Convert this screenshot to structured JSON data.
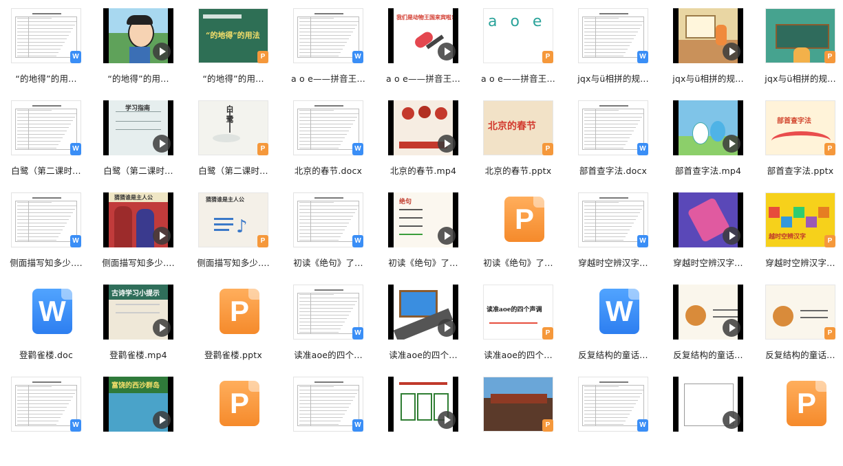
{
  "files": [
    {
      "label": "“的地得”的用...",
      "kind": "doc"
    },
    {
      "label": "“的地得”的用...",
      "kind": "video",
      "bg": "#5fa25a",
      "art": "cartoon"
    },
    {
      "label": "“的地得”的用...",
      "kind": "ppt",
      "bg": "#2e6f55",
      "art": "green"
    },
    {
      "label": "a o e——拼音王...",
      "kind": "doc"
    },
    {
      "label": "a o e——拼音王...",
      "kind": "video",
      "bg": "#ffffff",
      "art": "mic"
    },
    {
      "label": "a o e——拼音王...",
      "kind": "ppt",
      "bg": "#ffffff",
      "art": "aoe"
    },
    {
      "label": "jqx与ü相拼的规...",
      "kind": "doc"
    },
    {
      "label": "jqx与ü相拼的规...",
      "kind": "video",
      "bg": "#e9d6a3",
      "art": "classroom"
    },
    {
      "label": "jqx与ü相拼的规...",
      "kind": "ppt",
      "bg": "#46a38f",
      "art": "chalk"
    },
    {
      "label": "白鹭（第二课时...",
      "kind": "doc"
    },
    {
      "label": "白鹭（第二课时...",
      "kind": "video",
      "bg": "#e6eeee",
      "art": "scroll"
    },
    {
      "label": "白鹭（第二课时...",
      "kind": "ppt",
      "bg": "#f3f3ee",
      "art": "egret"
    },
    {
      "label": "北京的春节.docx",
      "kind": "doc"
    },
    {
      "label": "北京的春节.mp4",
      "kind": "video",
      "bg": "#f6ede2",
      "art": "food"
    },
    {
      "label": "北京的春节.pptx",
      "kind": "ppt",
      "bg": "#f2e2c7",
      "art": "spring"
    },
    {
      "label": "部首查字法.docx",
      "kind": "doc"
    },
    {
      "label": "部首查字法.mp4",
      "kind": "video",
      "bg": "#7fc4e8",
      "art": "rabbit"
    },
    {
      "label": "部首查字法.pptx",
      "kind": "ppt",
      "bg": "#fff3d9",
      "art": "rainbow"
    },
    {
      "label": "侧面描写知多少....",
      "kind": "doc"
    },
    {
      "label": "侧面描写知多少....",
      "kind": "video",
      "bg": "#c13b3b",
      "art": "people"
    },
    {
      "label": "侧面描写知多少....",
      "kind": "ppt",
      "bg": "#f4f0e8",
      "art": "music"
    },
    {
      "label": "初读《绝句》了...",
      "kind": "doc"
    },
    {
      "label": "初读《绝句》了...",
      "kind": "video",
      "bg": "#fbf7ef",
      "art": "poem"
    },
    {
      "label": "初读《绝句》了...",
      "kind": "pptbig"
    },
    {
      "label": "穿越时空辨汉字...",
      "kind": "doc"
    },
    {
      "label": "穿越时空辨汉字...",
      "kind": "video",
      "bg": "#5a48b8",
      "art": "phone"
    },
    {
      "label": "穿越时空辨汉字...",
      "kind": "ppt",
      "bg": "#f6d11b",
      "art": "blocks"
    },
    {
      "label": "登鹳雀楼.doc",
      "kind": "wordbig"
    },
    {
      "label": "登鹳雀楼.mp4",
      "kind": "video",
      "bg": "#efe8d8",
      "art": "tips"
    },
    {
      "label": "登鹳雀楼.pptx",
      "kind": "pptbig"
    },
    {
      "label": "读准aoe的四个...",
      "kind": "doc"
    },
    {
      "label": "读准aoe的四个...",
      "kind": "video",
      "bg": "#ffffff",
      "art": "road"
    },
    {
      "label": "读准aoe的四个...",
      "kind": "ppt",
      "bg": "#ffffff",
      "art": "tones"
    },
    {
      "label": "反复结构的童话...",
      "kind": "wordbig"
    },
    {
      "label": "反复结构的童话...",
      "kind": "video",
      "bg": "#faf6ec",
      "art": "fox"
    },
    {
      "label": "反复结构的童话...",
      "kind": "ppt",
      "bg": "#faf6ec",
      "art": "fox2"
    },
    {
      "label": "",
      "kind": "doc"
    },
    {
      "label": "",
      "kind": "video",
      "bg": "#2f7a3a",
      "art": "island"
    },
    {
      "label": "",
      "kind": "pptbig"
    },
    {
      "label": "",
      "kind": "doc"
    },
    {
      "label": "",
      "kind": "video",
      "bg": "#ffffff",
      "art": "chars"
    },
    {
      "label": "",
      "kind": "ppt",
      "bg": "#5b3a2a",
      "art": "palace"
    },
    {
      "label": "",
      "kind": "doc"
    },
    {
      "label": "",
      "kind": "video",
      "bg": "#ffffff",
      "art": "grid"
    },
    {
      "label": "",
      "kind": "pptbig"
    }
  ],
  "slide_texts": {
    "green": "“的地得”的用法",
    "aoe": "a o e",
    "mic": "我们是动物王国来宾啦!",
    "scroll": "学习指南",
    "egret": "白 鹭",
    "spring": "北京的春节",
    "rainbow": "部首查字法",
    "people": "猜猜谁是主人公",
    "music": "猜猜谁是主人公",
    "poem": "绝句",
    "blocks": "越时空辨汉字",
    "tips": "古诗学习小提示",
    "tones": "读准aoe的四个声调",
    "island": "富饶的西沙群岛"
  },
  "badges": {
    "word": "W",
    "ppt": "P"
  },
  "colors": {
    "word": "#3a8ef6",
    "ppt": "#f5983b"
  }
}
